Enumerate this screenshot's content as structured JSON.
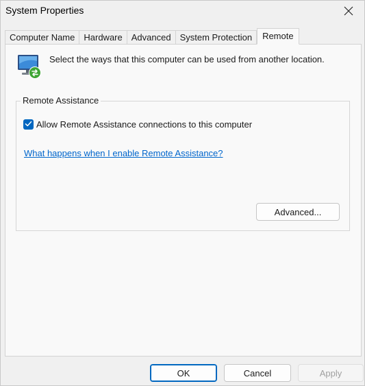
{
  "window": {
    "title": "System Properties"
  },
  "tabs": [
    {
      "label": "Computer Name",
      "active": false
    },
    {
      "label": "Hardware",
      "active": false
    },
    {
      "label": "Advanced",
      "active": false
    },
    {
      "label": "System Protection",
      "active": false
    },
    {
      "label": "Remote",
      "active": true
    }
  ],
  "remote": {
    "icon": "remote-desktop-monitor-icon",
    "intro": "Select the ways that this computer can be used from another location.",
    "assistance": {
      "legend": "Remote Assistance",
      "allow_label": "Allow Remote Assistance connections to this computer",
      "allow_checked": true,
      "help_link": "What happens when I enable Remote Assistance?",
      "advanced_label": "Advanced..."
    }
  },
  "footer": {
    "ok_label": "OK",
    "cancel_label": "Cancel",
    "apply_label": "Apply",
    "apply_enabled": false
  },
  "colors": {
    "accent": "#0067c0",
    "link": "#0066cc",
    "panel_bg": "#f9f9f9",
    "window_bg": "#f0f0f0"
  }
}
